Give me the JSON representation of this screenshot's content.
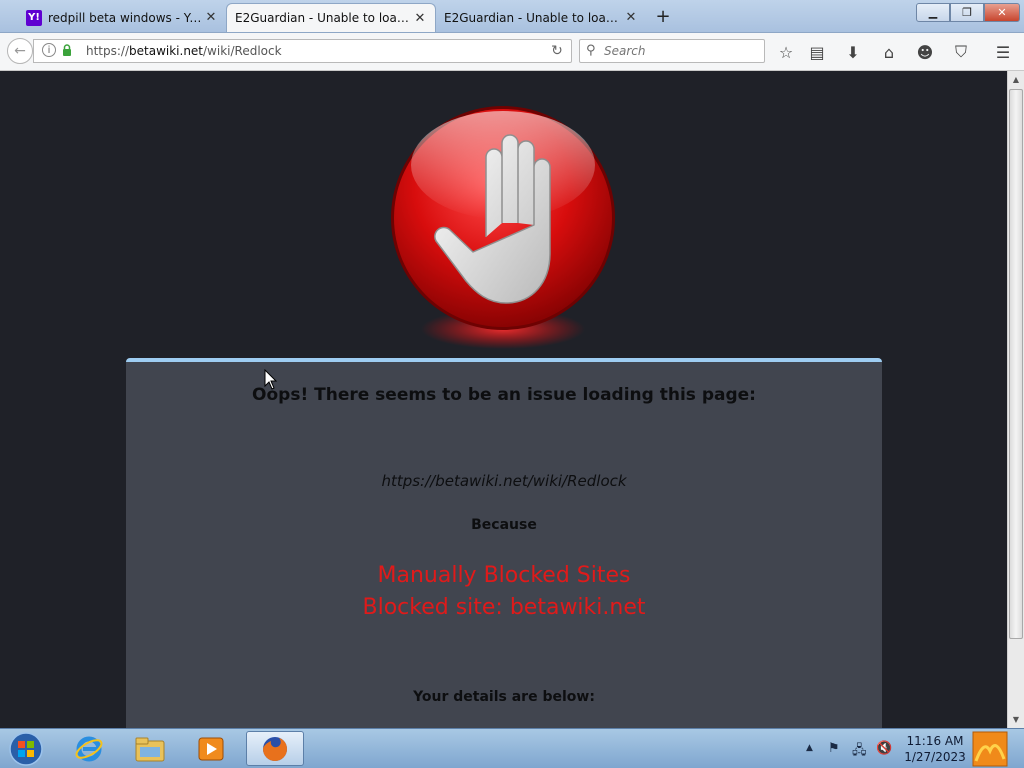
{
  "tabs": [
    {
      "title": "redpill beta windows - Yah...",
      "favicon": "Y!",
      "favicon_color": "#5f01d1",
      "active": false
    },
    {
      "title": "E2Guardian - Unable to load w...",
      "active": true
    },
    {
      "title": "E2Guardian - Unable to load w...",
      "active": false
    }
  ],
  "navbar": {
    "url_scheme": "https://",
    "url_host": "betawiki.net",
    "url_path": "/wiki/Redlock",
    "search_placeholder": "Search"
  },
  "page": {
    "heading": "Oops! There seems to be an issue loading this page:",
    "blocked_url": "https://betawiki.net/wiki/Redlock",
    "because": "Because",
    "reason_line1": "Manually Blocked Sites",
    "reason_line2": "Blocked site: betawiki.net",
    "details_heading": "Your details are below:"
  },
  "taskbar": {
    "time": "11:16 AM",
    "date": "1/27/2023"
  },
  "colors": {
    "accent_blue": "#9ecdf2",
    "error_red": "#e01a1a",
    "page_bg": "#1f2128",
    "card_bg": "#41454f"
  }
}
